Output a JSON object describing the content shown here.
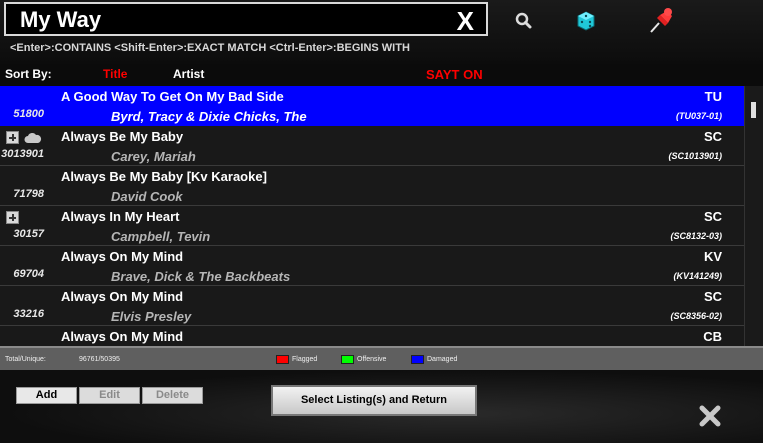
{
  "search": {
    "value": "My Way",
    "clear_label": "X",
    "hint": "<Enter>:CONTAINS <Shift-Enter>:EXACT MATCH <Ctrl-Enter>:BEGINS WITH"
  },
  "toolbar": {
    "icons": [
      "search-icon",
      "dice-icon",
      "pin-icon"
    ]
  },
  "sort": {
    "label": "Sort By:",
    "title_option": "Title",
    "artist_option": "Artist",
    "sayt": "SAYT ON"
  },
  "rows": [
    {
      "id": "51800",
      "title": "A Good Way To Get On My Bad Side",
      "artist": "Byrd, Tracy & Dixie Chicks, The",
      "brand": "TU",
      "code": "(TU037-01)",
      "selected": true,
      "expand": false,
      "cloud": false
    },
    {
      "id": "3013901",
      "title": "Always Be My Baby",
      "artist": "Carey, Mariah",
      "brand": "SC",
      "code": "(SC1013901)",
      "selected": false,
      "expand": true,
      "cloud": true
    },
    {
      "id": "71798",
      "title": "Always Be My Baby [Kv Karaoke]",
      "artist": "David Cook",
      "brand": "",
      "code": "",
      "selected": false,
      "expand": false,
      "cloud": false
    },
    {
      "id": "30157",
      "title": "Always In My Heart",
      "artist": "Campbell, Tevin",
      "brand": "SC",
      "code": "(SC8132-03)",
      "selected": false,
      "expand": true,
      "cloud": false
    },
    {
      "id": "69704",
      "title": "Always On My Mind",
      "artist": "Brave, Dick & The Backbeats",
      "brand": "KV",
      "code": "(KV141249)",
      "selected": false,
      "expand": false,
      "cloud": false
    },
    {
      "id": "33216",
      "title": "Always On My Mind",
      "artist": "Elvis Presley",
      "brand": "SC",
      "code": "(SC8356-02)",
      "selected": false,
      "expand": false,
      "cloud": false
    },
    {
      "id": "",
      "title": "Always On My Mind",
      "artist": "",
      "brand": "CB",
      "code": "",
      "selected": false,
      "expand": false,
      "cloud": false
    }
  ],
  "status": {
    "total_label": "Total/Unique:",
    "total_value": "96761/50395",
    "legend": [
      {
        "label": "Flagged",
        "color": "#ff0000"
      },
      {
        "label": "Offensive",
        "color": "#00ff00"
      },
      {
        "label": "Damaged",
        "color": "#0000ff"
      }
    ]
  },
  "buttons": {
    "add": "Add",
    "edit": "Edit",
    "delete": "Delete",
    "select": "Select Listing(s) and Return"
  },
  "colors": {
    "selection": "#0000ff",
    "sort_active": "#ff0000",
    "sayt": "#ff0000"
  }
}
